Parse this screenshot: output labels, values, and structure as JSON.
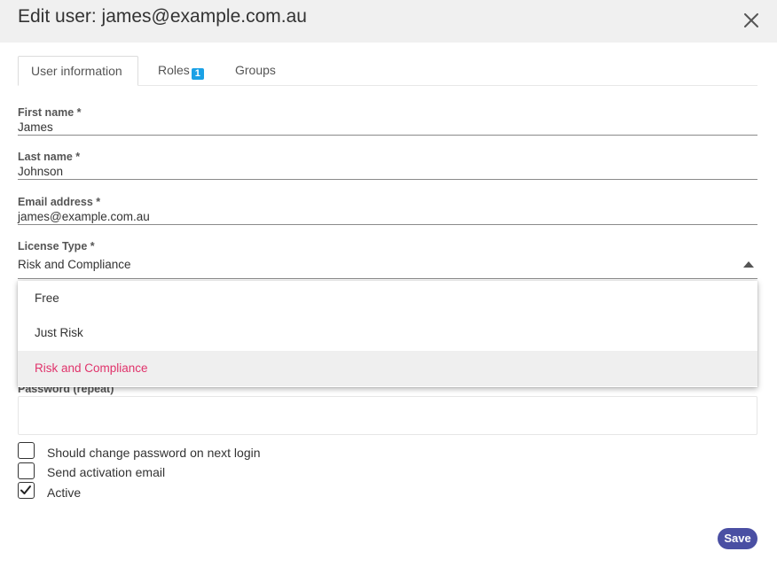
{
  "dialog": {
    "title": "Edit user: james@example.com.au",
    "close_icon": "close-icon"
  },
  "tabs": [
    {
      "label": "User information",
      "active": true
    },
    {
      "label": "Roles",
      "badge": "1",
      "active": false
    },
    {
      "label": "Groups",
      "active": false
    }
  ],
  "form": {
    "first_name": {
      "label": "First name *",
      "value": "James"
    },
    "last_name": {
      "label": "Last name *",
      "value": "Johnson"
    },
    "email": {
      "label": "Email address *",
      "value": "james@example.com.au"
    },
    "license_type": {
      "label": "License Type *",
      "value": "Risk and Compliance",
      "options": [
        "Free",
        "Just Risk",
        "Risk and Compliance"
      ],
      "expanded": true
    },
    "password_repeat": {
      "label": "Password (repeat)",
      "value": ""
    }
  },
  "checkboxes": [
    {
      "label": "Should change password on next login",
      "checked": false
    },
    {
      "label": "Send activation email",
      "checked": false
    },
    {
      "label": "Active",
      "checked": true
    }
  ],
  "actions": {
    "save_label": "Save"
  },
  "colors": {
    "header_bg": "#f0f0f0",
    "accent": "#e0336b",
    "badge": "#1aa1e6",
    "save_button": "#4a4fa3"
  }
}
